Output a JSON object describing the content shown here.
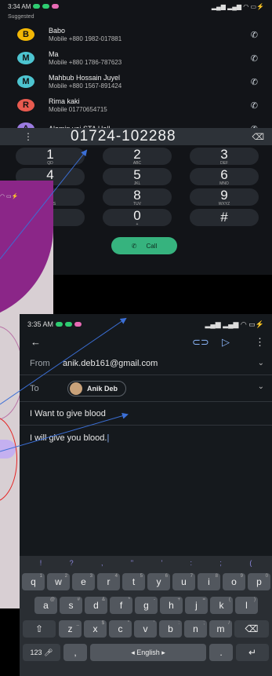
{
  "dialer": {
    "status_time": "3:34 AM",
    "section_label": "Suggested",
    "contacts": [
      {
        "initial": "B",
        "name": "Babo",
        "detail": "Mobile +880 1982-017881",
        "color": "#f2b705"
      },
      {
        "initial": "M",
        "name": "Ma",
        "detail": "Mobile +880 1786-787623",
        "color": "#4dc4d0"
      },
      {
        "initial": "M",
        "name": "Mahbub Hossain Juyel",
        "detail": "Mobile +880 1567-891424",
        "color": "#4dc4d0"
      },
      {
        "initial": "R",
        "name": "Rima kaki",
        "detail": "Mobile 01770654715",
        "color": "#e85a4f"
      },
      {
        "initial": "A",
        "name": "Alamin vai STA Hall",
        "detail": "",
        "color": "#9b7be0"
      }
    ],
    "dialed_number": "01724-102288",
    "keys": [
      {
        "digit": "1",
        "letters": "QD"
      },
      {
        "digit": "2",
        "letters": "ABC"
      },
      {
        "digit": "3",
        "letters": "DEF"
      },
      {
        "digit": "4",
        "letters": "GHI"
      },
      {
        "digit": "5",
        "letters": "JKL"
      },
      {
        "digit": "6",
        "letters": "MNO"
      },
      {
        "digit": "7",
        "letters": "PQRS"
      },
      {
        "digit": "8",
        "letters": "TUV"
      },
      {
        "digit": "9",
        "letters": "WXYZ"
      },
      {
        "digit": "*",
        "letters": ""
      },
      {
        "digit": "0",
        "letters": "+"
      },
      {
        "digit": "#",
        "letters": ""
      }
    ],
    "call_label": "Call"
  },
  "email": {
    "status_time": "3:35 AM",
    "from_label": "From",
    "from_value": "anik.deb161@gmail.com",
    "to_label": "To",
    "to_chip": "Anik Deb",
    "subject": "I Want to give blood",
    "body": "I will give you blood."
  },
  "keyboard": {
    "symbols": [
      "!",
      "?",
      ",",
      "\"",
      "'",
      ":",
      ";",
      "("
    ],
    "row1": [
      {
        "k": "q",
        "h": "1"
      },
      {
        "k": "w",
        "h": "2"
      },
      {
        "k": "e",
        "h": "3"
      },
      {
        "k": "r",
        "h": "4"
      },
      {
        "k": "t",
        "h": "5"
      },
      {
        "k": "y",
        "h": "6"
      },
      {
        "k": "u",
        "h": "7"
      },
      {
        "k": "i",
        "h": "8"
      },
      {
        "k": "o",
        "h": "9"
      },
      {
        "k": "p",
        "h": "0"
      }
    ],
    "row2": [
      {
        "k": "a",
        "h": "@"
      },
      {
        "k": "s",
        "h": "#"
      },
      {
        "k": "d",
        "h": "&"
      },
      {
        "k": "f",
        "h": "*"
      },
      {
        "k": "g",
        "h": "-"
      },
      {
        "k": "h",
        "h": "+"
      },
      {
        "k": "j",
        "h": "="
      },
      {
        "k": "k",
        "h": "("
      },
      {
        "k": "l",
        "h": ")"
      }
    ],
    "row3": [
      {
        "k": "z",
        "h": "_"
      },
      {
        "k": "x",
        "h": "$"
      },
      {
        "k": "c",
        "h": "\""
      },
      {
        "k": "v",
        "h": "'"
      },
      {
        "k": "b",
        "h": ":"
      },
      {
        "k": "n",
        "h": ";"
      },
      {
        "k": "m",
        "h": "/"
      }
    ],
    "numbers_key": "123",
    "comma_key": ",",
    "space_label": "English",
    "period_key": "."
  },
  "colors": {
    "accent_arrow": "#3b6fd6",
    "call_green": "#36b37e"
  }
}
